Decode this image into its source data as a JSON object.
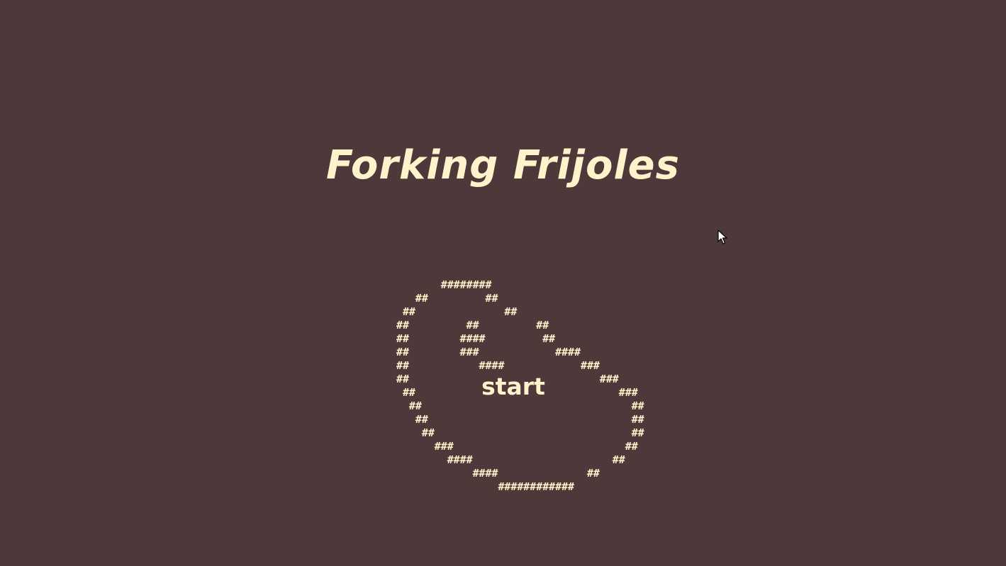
{
  "title": "Forking Frijoles",
  "start_label": "start",
  "bean_art": "       ########\n   ##         ##\n ##              ##\n##         ##         ##\n##        ####         ##\n##        ###            ####\n##           ####            ###\n##                              ###\n ##                                ###\n  ##                                 ##\n   ##                                ##\n    ##                               ##\n      ###                           ##\n        ####                      ##\n            ####              ##\n                ############",
  "colors": {
    "background": "#4d393a",
    "foreground": "#fff3cc"
  },
  "cursor_icon": "mouse-pointer-icon"
}
